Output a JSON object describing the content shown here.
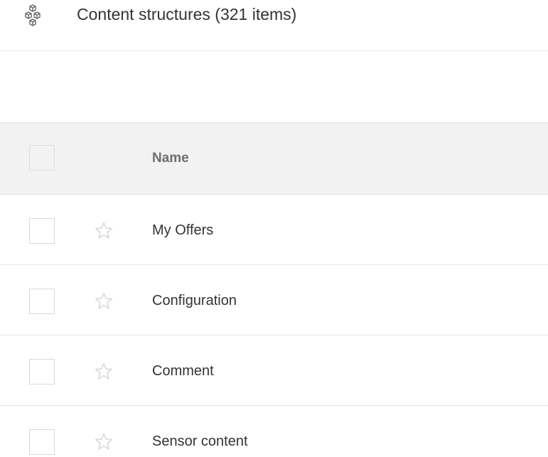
{
  "header": {
    "icon": "content-structures-icon",
    "title": "Content structures (321 items)"
  },
  "table": {
    "columns": [
      {
        "label": "Name"
      }
    ],
    "rows": [
      {
        "name": "My Offers",
        "starred": false
      },
      {
        "name": "Configuration",
        "starred": false
      },
      {
        "name": "Comment",
        "starred": false
      },
      {
        "name": "Sensor content",
        "starred": false
      }
    ]
  },
  "colors": {
    "header_background": "#f2f2f2",
    "border": "#e3e3e3",
    "text": "#333333",
    "muted_text": "#6e6e6e",
    "star": "#d6d6d6"
  }
}
